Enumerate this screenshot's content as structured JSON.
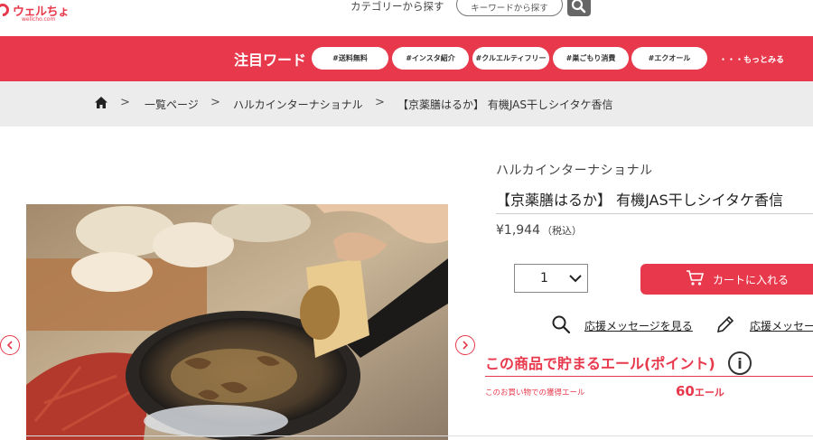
{
  "header": {
    "logo_text": "ウェルちょ",
    "logo_sub": "wellcho.com",
    "category_link": "カテゴリーから探す",
    "keyword_search": "キーワードから探す"
  },
  "featured": {
    "label": "注目ワード",
    "tags": [
      "#送料無料",
      "#インスタ紹介",
      "#クルエルティフリー",
      "#巣ごもり消費",
      "#エクオール"
    ],
    "more": "・・・もっとみる"
  },
  "breadcrumb": {
    "items": [
      "一覧ページ",
      "ハルカインターナショナル",
      "【京薬膳はるか】 有機JAS干しシイタケ香信"
    ],
    "separator": ">"
  },
  "product": {
    "brand": "ハルカインターナショナル",
    "title": "【京薬膳はるか】 有機JAS干しシイタケ香信",
    "price": "¥1,944",
    "tax_note": "（税込）",
    "quantity": "1",
    "cart_button": "カートに入れる",
    "view_messages": "応援メッセージを見る",
    "write_message": "応援メッセー"
  },
  "yell": {
    "title": "この商品で貯まるエール(ポイント)",
    "info_symbol": "i",
    "subtitle": "このお買い物での獲得エール",
    "points": "60",
    "unit": "エール"
  },
  "colors": {
    "accent": "#e8394c",
    "crumb_bg": "#ececec"
  },
  "icons": [
    "search-icon",
    "home-icon",
    "chevron-down-icon",
    "cart-icon",
    "magnifier-icon",
    "pencil-icon",
    "info-icon",
    "arrow-left-icon",
    "arrow-right-icon"
  ]
}
